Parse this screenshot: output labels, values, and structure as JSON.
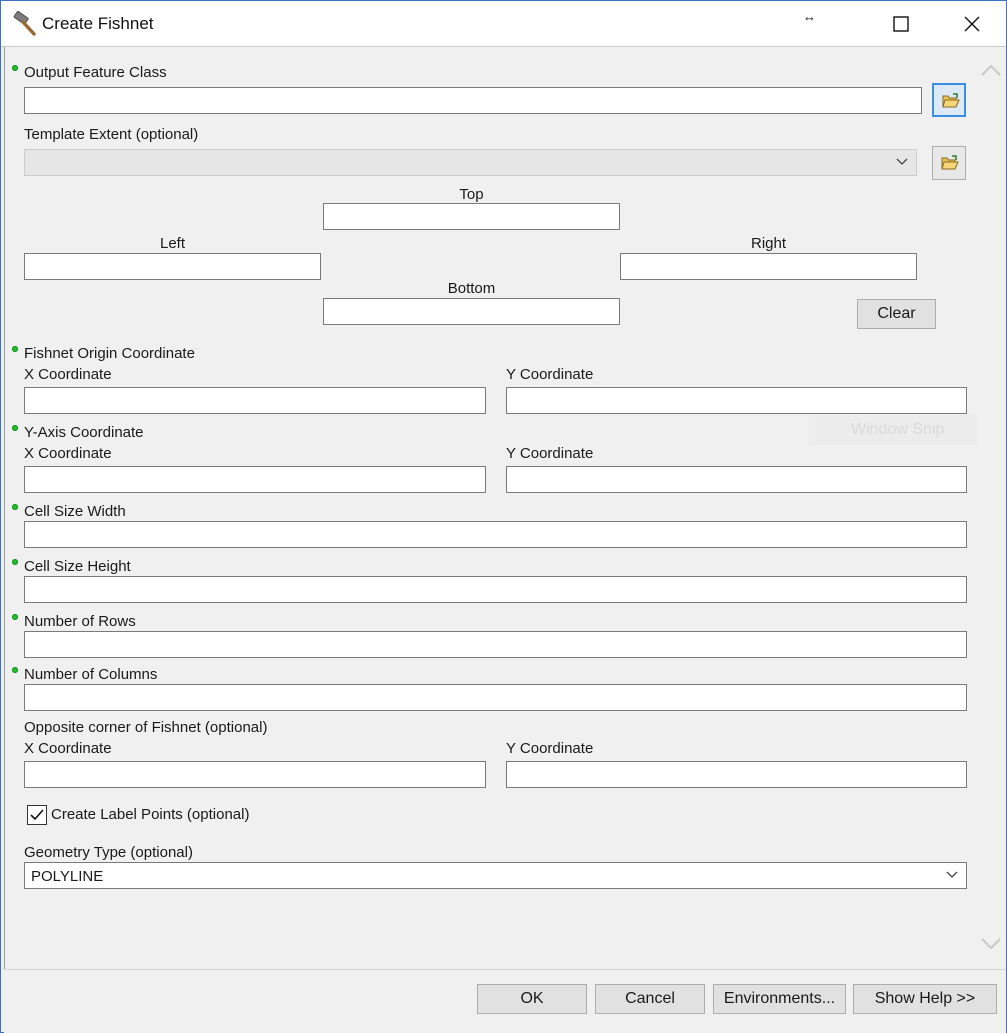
{
  "window": {
    "title": "Create Fishnet",
    "resize_glyph": "↔",
    "icon": "hammer-icon"
  },
  "form": {
    "output_feature_class": {
      "label": "Output Feature Class",
      "value": ""
    },
    "template_extent": {
      "label": "Template Extent (optional)",
      "value": ""
    },
    "extent": {
      "top_label": "Top",
      "left_label": "Left",
      "right_label": "Right",
      "bottom_label": "Bottom",
      "clear_label": "Clear"
    },
    "fishnet_origin": {
      "label": "Fishnet Origin Coordinate",
      "x_label": "X Coordinate",
      "y_label": "Y Coordinate"
    },
    "y_axis": {
      "label": "Y-Axis Coordinate",
      "x_label": "X Coordinate",
      "y_label": "Y Coordinate"
    },
    "cell_width": {
      "label": "Cell Size Width"
    },
    "cell_height": {
      "label": "Cell Size Height"
    },
    "num_rows": {
      "label": "Number of Rows"
    },
    "num_columns": {
      "label": "Number of Columns"
    },
    "opposite_corner": {
      "label": "Opposite corner of Fishnet (optional)",
      "x_label": "X Coordinate",
      "y_label": "Y Coordinate"
    },
    "label_points": {
      "label": "Create Label Points (optional)",
      "checked": true
    },
    "geometry_type": {
      "label": "Geometry Type (optional)",
      "value": "POLYLINE"
    }
  },
  "overlay": {
    "watermark_text": "Window Snip"
  },
  "footer": {
    "ok_label": "OK",
    "cancel_label": "Cancel",
    "environments_label": "Environments...",
    "show_help_label": "Show Help >>"
  },
  "colors": {
    "required_dot": "#22c02a",
    "focus_border": "#3b8ee0",
    "window_border": "#3a73c4"
  }
}
